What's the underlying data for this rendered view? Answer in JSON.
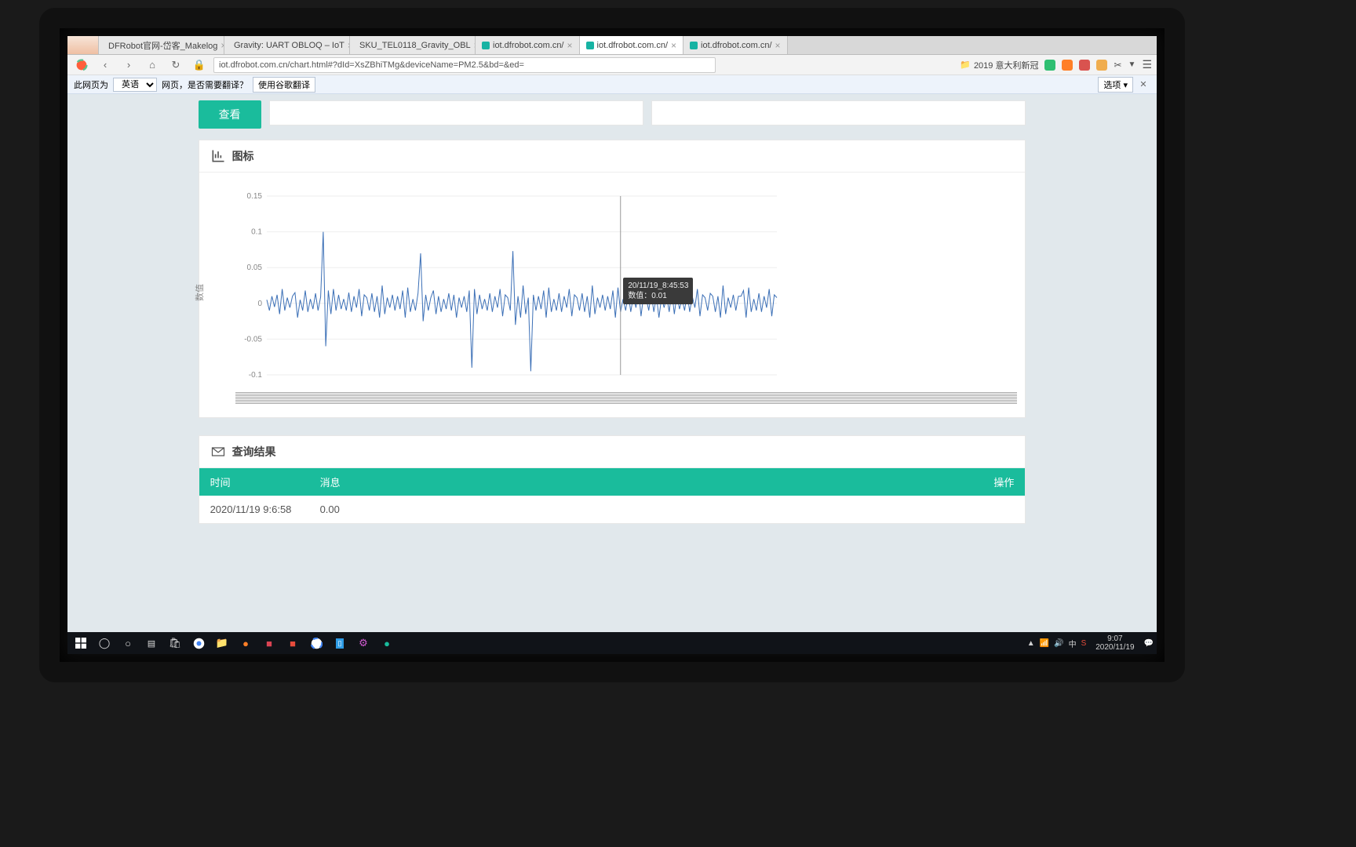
{
  "tabs": [
    {
      "label": "DFRobot官网-岱客_Makelog",
      "favicon": "df"
    },
    {
      "label": "Gravity: UART OBLOQ – IoT",
      "favicon": "df"
    },
    {
      "label": "SKU_TEL0118_Gravity_OBL",
      "favicon": "df"
    },
    {
      "label": "iot.dfrobot.com.cn/",
      "favicon": "iot"
    },
    {
      "label": "iot.dfrobot.com.cn/",
      "favicon": "iot",
      "active": true
    },
    {
      "label": "iot.dfrobot.com.cn/",
      "favicon": "iot"
    }
  ],
  "address_bar": {
    "url": "iot.dfrobot.com.cn/chart.html#?dId=XsZBhiTMg&deviceName=PM2.5&bd=&ed=",
    "bookmark_label": "2019 意大利新冠"
  },
  "translate_bar": {
    "prefix": "此网页为",
    "lang_selected": "英语",
    "mid": "网页，是否需要翻译？",
    "translate_btn": "使用谷歌翻译",
    "options_btn": "选项"
  },
  "page": {
    "view_btn": "查看",
    "chart_title": "图标",
    "y_axis_label": "数值",
    "tooltip_time": "20/11/19_8:45:53",
    "tooltip_value": "数值：0.01",
    "results_title": "查询结果",
    "results_cols": {
      "time": "时间",
      "msg": "消息",
      "op": "操作"
    },
    "results_rows": [
      {
        "time": "2020/11/19 9:6:58",
        "msg": "0.00"
      }
    ]
  },
  "taskbar": {
    "time": "9:07",
    "date": "2020/11/19"
  },
  "chart_data": {
    "type": "line",
    "title": "图标",
    "ylabel": "数值",
    "ylim": [
      -0.1,
      0.15
    ],
    "yticks": [
      -0.1,
      -0.05,
      0,
      0.05,
      0.1,
      0.15
    ],
    "x_count": 200,
    "values": [
      0.005,
      -0.01,
      0.01,
      -0.005,
      0.012,
      -0.015,
      0.02,
      -0.01,
      0.008,
      -0.006,
      0.01,
      0.015,
      -0.02,
      0.005,
      -0.01,
      0.018,
      -0.012,
      0.006,
      -0.008,
      0.014,
      -0.01,
      0.009,
      0.1,
      -0.06,
      0.018,
      -0.015,
      0.02,
      -0.01,
      0.012,
      -0.008,
      0.006,
      -0.01,
      0.015,
      -0.012,
      0.01,
      -0.006,
      0.02,
      -0.018,
      0.012,
      0.008,
      -0.01,
      0.014,
      -0.012,
      0.01,
      -0.02,
      0.025,
      -0.015,
      0.008,
      -0.006,
      0.012,
      -0.01,
      0.01,
      -0.008,
      0.018,
      -0.02,
      0.022,
      -0.012,
      0.006,
      -0.01,
      0.014,
      0.07,
      -0.025,
      0.012,
      -0.01,
      0.008,
      0.018,
      -0.015,
      0.01,
      -0.012,
      0.006,
      -0.008,
      0.014,
      -0.01,
      0.012,
      -0.02,
      0.008,
      -0.006,
      0.01,
      -0.012,
      0.018,
      -0.09,
      0.02,
      -0.015,
      0.012,
      -0.008,
      0.006,
      -0.01,
      0.014,
      -0.012,
      0.01,
      -0.006,
      0.02,
      -0.018,
      0.012,
      0.008,
      -0.01,
      0.073,
      -0.03,
      0.01,
      -0.02,
      0.025,
      -0.015,
      0.008,
      -0.095,
      0.012,
      -0.01,
      0.01,
      -0.008,
      0.018,
      -0.02,
      0.022,
      -0.012,
      0.006,
      -0.01,
      0.014,
      -0.012,
      0.01,
      -0.006,
      0.02,
      -0.018,
      0.012,
      0.008,
      -0.01,
      0.014,
      -0.012,
      0.01,
      -0.02,
      0.025,
      -0.015,
      0.008,
      -0.006,
      0.012,
      -0.01,
      0.01,
      -0.008,
      0.018,
      -0.02,
      0.022,
      -0.012,
      0.006,
      -0.01,
      0.014,
      -0.012,
      0.01,
      -0.006,
      0.02,
      -0.018,
      0.012,
      0.008,
      -0.01,
      0.014,
      -0.012,
      0.01,
      -0.02,
      0.008,
      -0.006,
      0.01,
      -0.012,
      0.018,
      -0.015,
      0.012,
      -0.008,
      0.006,
      -0.01,
      0.014,
      -0.012,
      0.01,
      -0.006,
      0.02,
      -0.018,
      0.012,
      0.008,
      -0.01,
      0.014,
      0.01,
      -0.012,
      0.01,
      -0.02,
      0.025,
      -0.015,
      0.008,
      -0.006,
      0.012,
      -0.01,
      0.01,
      0.01,
      0.018,
      -0.02,
      0.022,
      -0.012,
      0.006,
      -0.01,
      0.014,
      -0.012,
      0.01,
      -0.006,
      0.02,
      -0.018,
      0.012,
      0.008
    ],
    "tooltip": {
      "index": 138,
      "time": "20/11/19_8:45:53",
      "value": 0.01
    }
  }
}
